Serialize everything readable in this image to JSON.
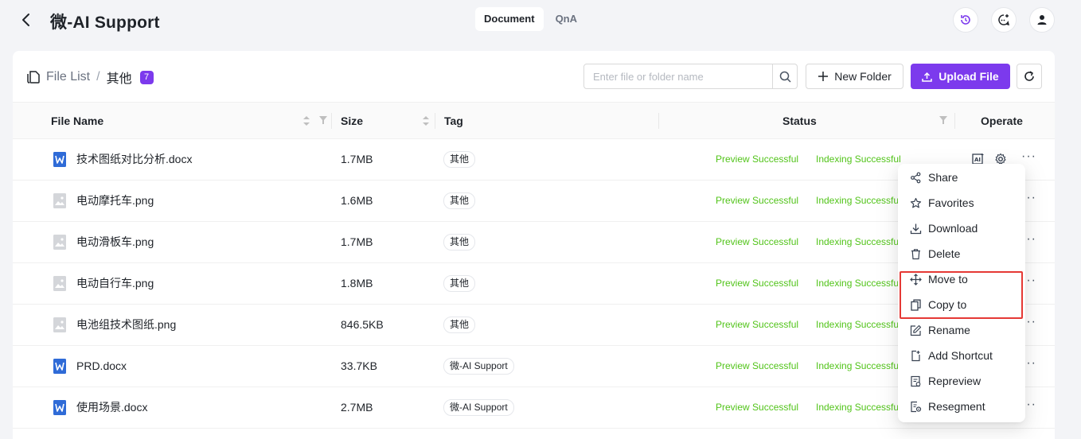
{
  "header": {
    "title": "微-AI Support",
    "tabs": [
      {
        "label": "Document",
        "active": true
      },
      {
        "label": "QnA",
        "active": false
      }
    ]
  },
  "toolbar": {
    "breadcrumb_root": "File List",
    "breadcrumb_separator": "/",
    "breadcrumb_current": "其他",
    "file_count": "7",
    "search_placeholder": "Enter file or folder name",
    "new_folder_label": "New Folder",
    "upload_label": "Upload File"
  },
  "table": {
    "columns": {
      "name": "File Name",
      "size": "Size",
      "tag": "Tag",
      "status": "Status",
      "operate": "Operate"
    },
    "rows": [
      {
        "name": "技术图纸对比分析.docx",
        "type": "doc",
        "size": "1.7MB",
        "tag": "其他",
        "preview": "Preview Successful",
        "indexing": "Indexing Successful"
      },
      {
        "name": "电动摩托车.png",
        "type": "image",
        "size": "1.6MB",
        "tag": "其他",
        "preview": "Preview Successful",
        "indexing": "Indexing Successful"
      },
      {
        "name": "电动滑板车.png",
        "type": "image",
        "size": "1.7MB",
        "tag": "其他",
        "preview": "Preview Successful",
        "indexing": "Indexing Successful"
      },
      {
        "name": "电动自行车.png",
        "type": "image",
        "size": "1.8MB",
        "tag": "其他",
        "preview": "Preview Successful",
        "indexing": "Indexing Successful"
      },
      {
        "name": "电池组技术图纸.png",
        "type": "image",
        "size": "846.5KB",
        "tag": "其他",
        "preview": "Preview Successful",
        "indexing": "Indexing Successful"
      },
      {
        "name": "PRD.docx",
        "type": "doc",
        "size": "33.7KB",
        "tag": "微-AI Support",
        "preview": "Preview Successful",
        "indexing": "Indexing Successful"
      },
      {
        "name": "使用场景.docx",
        "type": "doc",
        "size": "2.7MB",
        "tag": "微-AI Support",
        "preview": "Preview Successful",
        "indexing": "Indexing Successful"
      }
    ]
  },
  "context_menu": {
    "items": [
      {
        "label": "Share",
        "icon": "share-icon"
      },
      {
        "label": "Favorites",
        "icon": "star-icon"
      },
      {
        "label": "Download",
        "icon": "download-icon"
      },
      {
        "label": "Delete",
        "icon": "trash-icon"
      },
      {
        "label": "Move to",
        "icon": "move-icon"
      },
      {
        "label": "Copy to",
        "icon": "copy-icon"
      },
      {
        "label": "Rename",
        "icon": "rename-icon"
      },
      {
        "label": "Add Shortcut",
        "icon": "add-shortcut-icon"
      },
      {
        "label": "Repreview",
        "icon": "repreview-icon"
      },
      {
        "label": "Resegment",
        "icon": "resegment-icon"
      }
    ],
    "highlighted": [
      "Move to",
      "Copy to"
    ]
  },
  "colors": {
    "accent": "#7c3aed",
    "success": "#52c41a",
    "highlight_border": "#e53935",
    "doc_icon": "#2f6bd7"
  }
}
